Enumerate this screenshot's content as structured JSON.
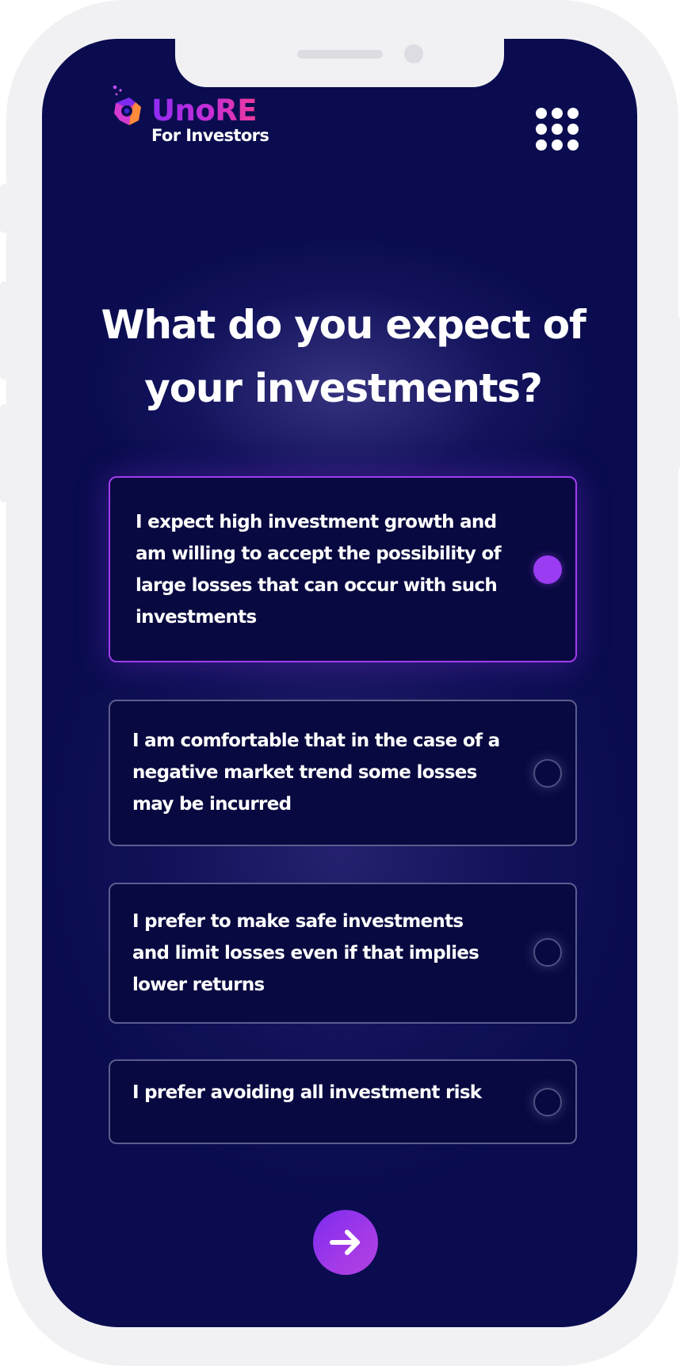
{
  "header": {
    "logo_title": "UnoRE",
    "logo_subtitle": "For Investors",
    "menu_icon": "grid-dots-icon"
  },
  "question": {
    "line1": "What do you expect of",
    "line2": "your investments?"
  },
  "options": [
    {
      "lines": [
        "I expect high investment growth and",
        "am willing to accept the possibility of",
        "large losses that can occur with such",
        "investments"
      ],
      "selected": true
    },
    {
      "lines": [
        "I am comfortable that in the case of a",
        "negative market trend some losses",
        "may be incurred"
      ],
      "selected": false
    },
    {
      "lines": [
        "I prefer to make safe investments",
        "and limit losses even if that implies",
        "lower returns"
      ],
      "selected": false
    },
    {
      "lines": [
        "I prefer avoiding all investment risk"
      ],
      "selected": false
    }
  ],
  "next": {
    "icon": "arrow-right-icon"
  },
  "colors": {
    "screen_bg": "#0a0c4f",
    "card_bg": "#080940",
    "accent": "#9a3cf2",
    "selected_border": "#a23cf0",
    "card_border": "#5b5d8e"
  }
}
